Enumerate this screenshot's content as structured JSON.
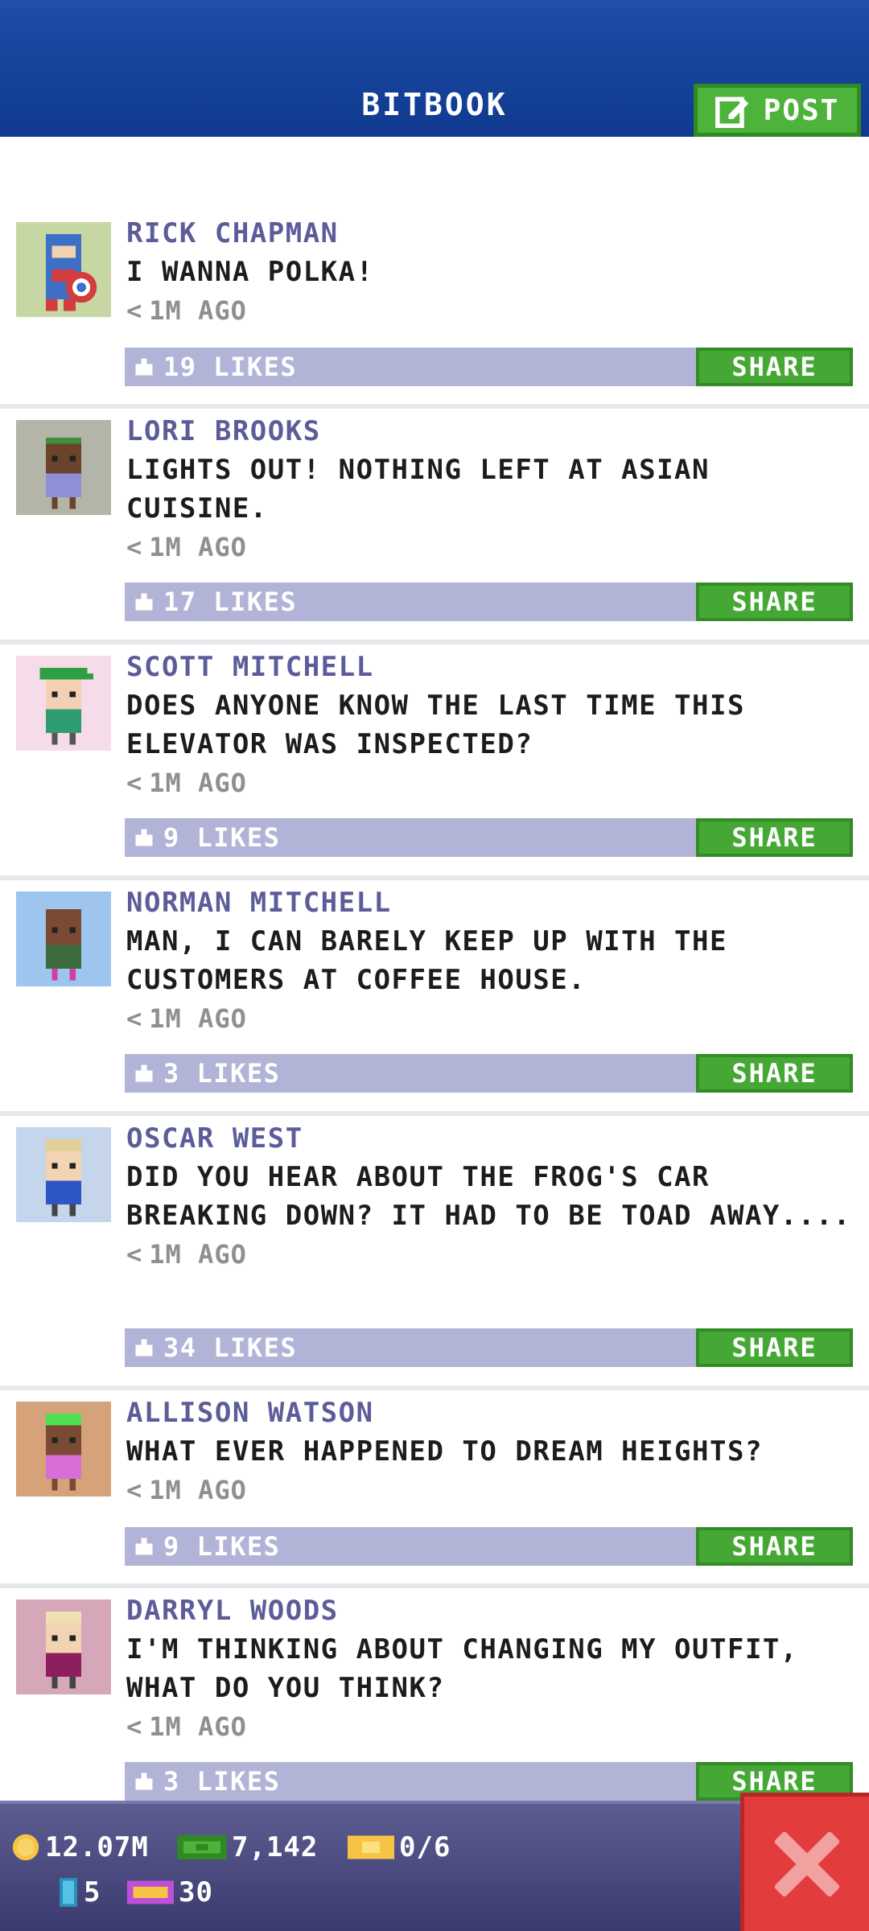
{
  "header": {
    "title": "BITBOOK",
    "post_label": "POST"
  },
  "posts": [
    {
      "name": "RICK CHAPMAN",
      "text": "I WANNA POLKA!",
      "time": "1M AGO",
      "likes": "19 LIKES",
      "share": "SHARE",
      "avatar_bg": "#c7d7a4"
    },
    {
      "name": "LORI BROOKS",
      "text": "LIGHTS OUT! NOTHING LEFT AT ASIAN CUISINE.",
      "time": "1M AGO",
      "likes": "17 LIKES",
      "share": "SHARE",
      "avatar_bg": "#b3b5a9"
    },
    {
      "name": "SCOTT MITCHELL",
      "text": "DOES ANYONE KNOW THE LAST TIME THIS ELEVATOR WAS INSPECTED?",
      "time": "1M AGO",
      "likes": "9 LIKES",
      "share": "SHARE",
      "avatar_bg": "#f6dbe8"
    },
    {
      "name": "NORMAN MITCHELL",
      "text": "MAN, I CAN BARELY KEEP UP WITH THE CUSTOMERS AT COFFEE HOUSE.",
      "time": "1M AGO",
      "likes": "3 LIKES",
      "share": "SHARE",
      "avatar_bg": "#9ec5ee"
    },
    {
      "name": "OSCAR WEST",
      "text": "DID YOU HEAR ABOUT THE FROG'S CAR BREAKING DOWN? IT HAD TO BE TOAD AWAY....",
      "time": "1M AGO",
      "likes": "34 LIKES",
      "share": "SHARE",
      "avatar_bg": "#c4d5ec"
    },
    {
      "name": "ALLISON WATSON",
      "text": "WHAT EVER HAPPENED TO DREAM HEIGHTS?",
      "time": "1M AGO",
      "likes": "9 LIKES",
      "share": "SHARE",
      "avatar_bg": "#d6a27a"
    },
    {
      "name": "DARRYL WOODS",
      "text": "I'M THINKING ABOUT CHANGING MY OUTFIT, WHAT DO YOU THINK?",
      "time": "1M AGO",
      "likes": "3 LIKES",
      "share": "SHARE",
      "avatar_bg": "#d6a7b9"
    }
  ],
  "status": {
    "coins": "12.07M",
    "bux": "7,142",
    "tickets": "0/6",
    "elevator": "5",
    "vip": "30"
  },
  "colors": {
    "header": "#1f4aa6",
    "green": "#45a834",
    "likebar": "#b1b4d6",
    "close": "#e23c3c"
  }
}
